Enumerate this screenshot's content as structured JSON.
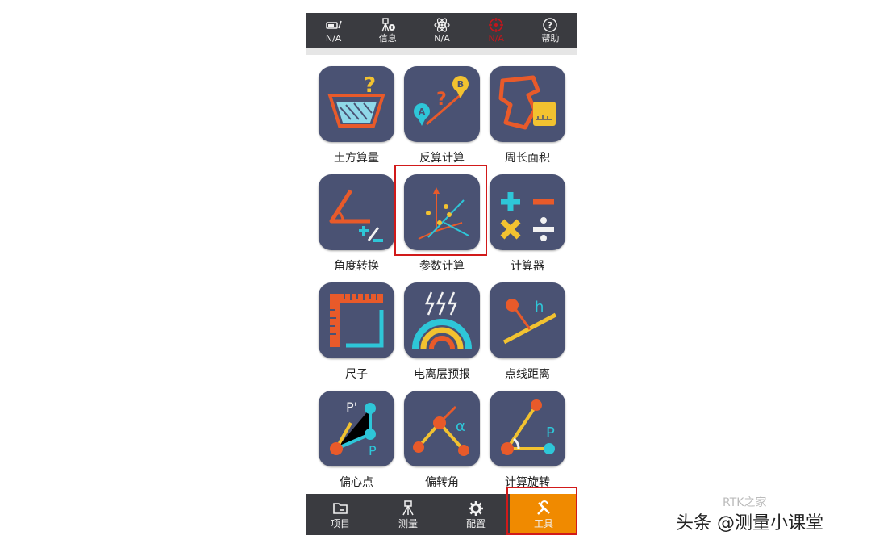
{
  "topbar": {
    "items": [
      {
        "label": "N/A",
        "icon": "battery-pen-icon"
      },
      {
        "label": "信息",
        "icon": "gnss-info-icon"
      },
      {
        "label": "N/A",
        "icon": "atom-icon"
      },
      {
        "label": "N/A",
        "icon": "target-icon",
        "color": "#c4161c"
      },
      {
        "label": "帮助",
        "icon": "help-icon"
      }
    ]
  },
  "tools": [
    {
      "label": "土方算量",
      "icon": "earthwork-icon"
    },
    {
      "label": "反算计算",
      "icon": "inverse-calc-icon"
    },
    {
      "label": "周长面积",
      "icon": "perimeter-area-icon"
    },
    {
      "label": "角度转换",
      "icon": "angle-convert-icon"
    },
    {
      "label": "参数计算",
      "icon": "parameter-calc-icon"
    },
    {
      "label": "计算器",
      "icon": "calculator-icon"
    },
    {
      "label": "尺子",
      "icon": "ruler-icon"
    },
    {
      "label": "电离层预报",
      "icon": "ionosphere-icon"
    },
    {
      "label": "点线距离",
      "icon": "point-line-distance-icon"
    },
    {
      "label": "偏心点",
      "icon": "eccentric-point-icon"
    },
    {
      "label": "偏转角",
      "icon": "deflection-angle-icon"
    },
    {
      "label": "计算旋转",
      "icon": "calc-rotation-icon"
    }
  ],
  "bottombar": {
    "items": [
      {
        "label": "项目",
        "icon": "folder-icon"
      },
      {
        "label": "测量",
        "icon": "survey-icon"
      },
      {
        "label": "配置",
        "icon": "gear-icon"
      },
      {
        "label": "工具",
        "icon": "tools-icon",
        "active": true
      }
    ],
    "active_color": "#f08a00"
  },
  "watermark": {
    "text": "头条 @测量小课堂",
    "faint_text": "RTK之家"
  },
  "colors": {
    "bar": "#3a3b40",
    "tile": "#4a5273",
    "highlight": "#d11a1a"
  }
}
